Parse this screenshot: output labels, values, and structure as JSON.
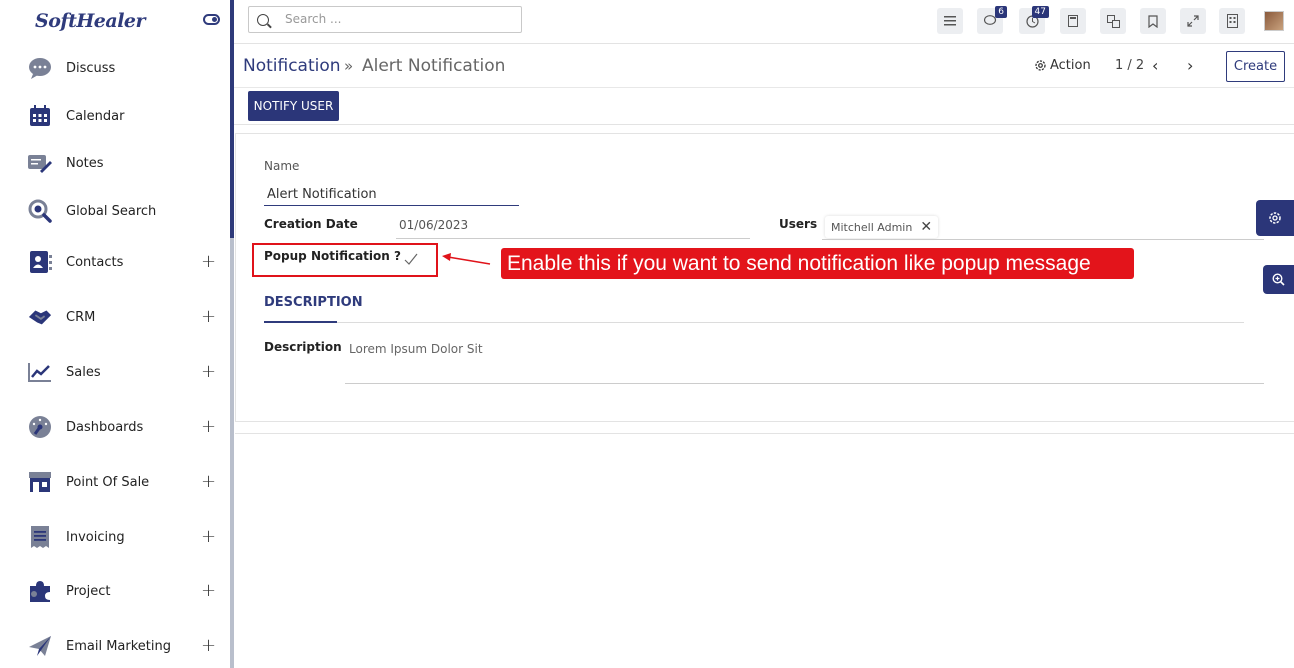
{
  "sidebar": {
    "logo": "SoftHealer",
    "items": [
      {
        "label": "Discuss",
        "icon": "chat-bubble-icon",
        "expandable": false
      },
      {
        "label": "Calendar",
        "icon": "calendar-icon",
        "expandable": false
      },
      {
        "label": "Notes",
        "icon": "notes-icon",
        "expandable": false
      },
      {
        "label": "Global Search",
        "icon": "global-search-icon",
        "expandable": false
      },
      {
        "label": "Contacts",
        "icon": "contacts-icon",
        "expandable": true
      },
      {
        "label": "CRM",
        "icon": "handshake-icon",
        "expandable": true
      },
      {
        "label": "Sales",
        "icon": "chart-line-icon",
        "expandable": true
      },
      {
        "label": "Dashboards",
        "icon": "gauge-icon",
        "expandable": true
      },
      {
        "label": "Point Of Sale",
        "icon": "store-icon",
        "expandable": true
      },
      {
        "label": "Invoicing",
        "icon": "invoice-icon",
        "expandable": true
      },
      {
        "label": "Project",
        "icon": "puzzle-icon",
        "expandable": true
      },
      {
        "label": "Email Marketing",
        "icon": "paper-plane-icon",
        "expandable": true
      }
    ],
    "expand_symbol": "+"
  },
  "topbar": {
    "search_placeholder": "Search ...",
    "messages_badge": "6",
    "activities_badge": "47"
  },
  "breadcrumb": {
    "parent": "Notification",
    "separator": "»",
    "current": "Alert Notification"
  },
  "control": {
    "action_label": "Action",
    "pager": "1 / 2",
    "create_label": "Create"
  },
  "statusbar": {
    "notify_user_label": "NOTIFY USER"
  },
  "form": {
    "name_label": "Name",
    "name_value": "Alert Notification",
    "creation_date_label": "Creation Date",
    "creation_date_value": "01/06/2023",
    "users_label": "Users",
    "users_tag": "Mitchell Admin",
    "popup_label": "Popup Notification ?",
    "popup_checked": true,
    "description_tab": "DESCRIPTION",
    "description_label": "Description",
    "description_value": "Lorem Ipsum Dolor Sit"
  },
  "annotation": {
    "callout_text": "Enable this if you want to send notification like popup message",
    "color": "#e3141b"
  },
  "colors": {
    "brand": "#2b3679",
    "accent_text": "#2f3b7c"
  }
}
